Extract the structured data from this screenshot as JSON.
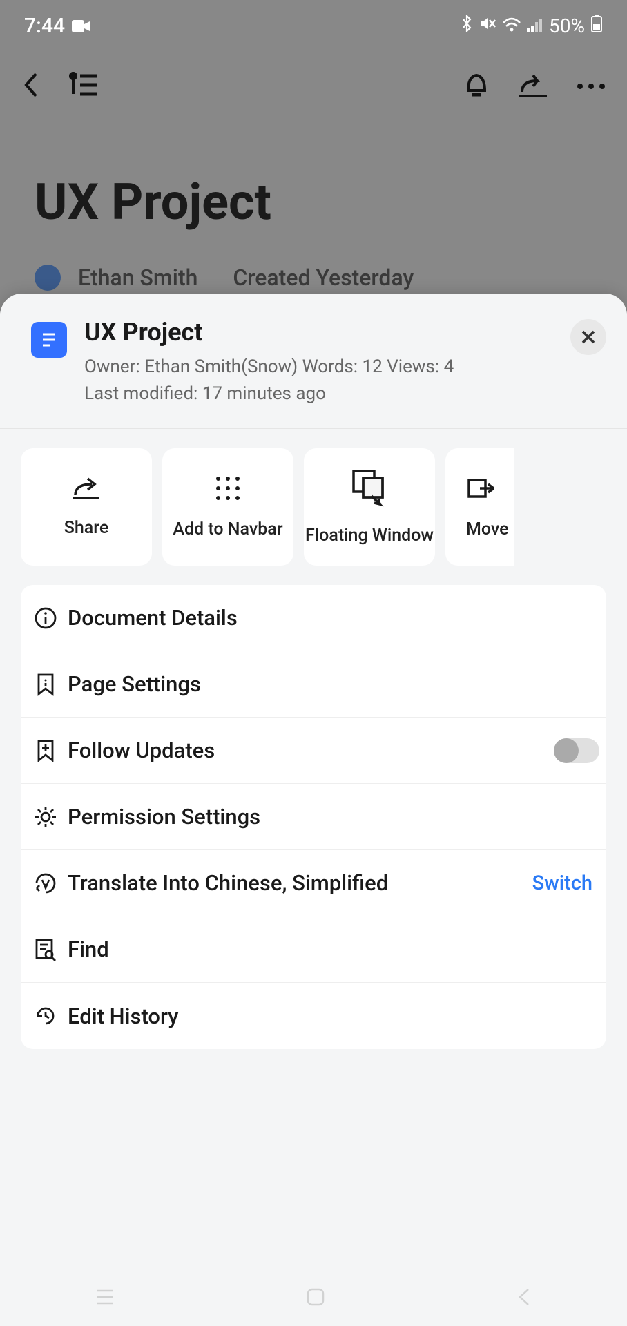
{
  "status": {
    "time": "7:44",
    "battery_pct": "50%"
  },
  "background_page": {
    "title": "UX Project",
    "author": "Ethan Smith",
    "created_line": "Created Yesterday"
  },
  "sheet": {
    "title": "UX Project",
    "meta_line1": "Owner: Ethan Smith(Snow)   Words: 12   Views: 4",
    "meta_line2": "Last modified: 17 minutes ago"
  },
  "actions": {
    "share": "Share",
    "add_navbar": "Add to Navbar",
    "floating": "Floating Window",
    "move": "Move"
  },
  "menu": {
    "doc_details": "Document Details",
    "page_settings": "Page Settings",
    "follow_updates": "Follow Updates",
    "permission": "Permission Settings",
    "translate": "Translate Into Chinese, Simplified",
    "switch_label": "Switch",
    "find": "Find",
    "edit_history": "Edit History"
  }
}
